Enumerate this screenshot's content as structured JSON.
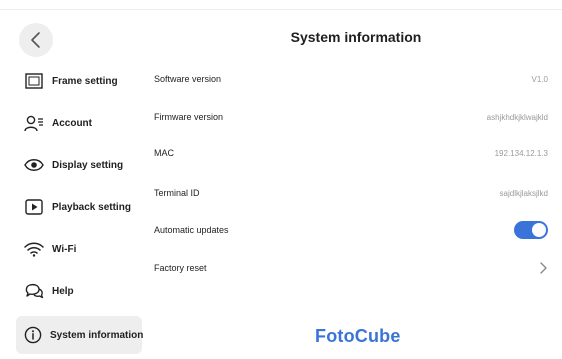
{
  "header": {
    "title": "System information"
  },
  "sidebar": {
    "items": [
      {
        "label": "Frame setting",
        "icon": "frame-icon"
      },
      {
        "label": "Account",
        "icon": "account-icon"
      },
      {
        "label": "Display setting",
        "icon": "eye-icon"
      },
      {
        "label": "Playback setting",
        "icon": "play-icon"
      },
      {
        "label": "Wi-Fi",
        "icon": "wifi-icon"
      },
      {
        "label": "Help",
        "icon": "help-chat-icon"
      },
      {
        "label": "System information",
        "icon": "info-icon",
        "active": true
      }
    ]
  },
  "main": {
    "rows": [
      {
        "label": "Software version",
        "value": "V1.0"
      },
      {
        "label": "Firmware version",
        "value": "ashjkhdkjklwajkld"
      },
      {
        "label": "MAC",
        "value": "192.134.12.1.3"
      },
      {
        "label": "Terminal ID",
        "value": "sajdlkjlaksjlkd"
      },
      {
        "label": "Automatic updates",
        "toggle_on": true
      },
      {
        "label": "Factory reset",
        "icon": "chevron-right-icon"
      }
    ]
  },
  "brand": {
    "logo_text": "FotoCube",
    "accent_color": "#3a74d9"
  }
}
